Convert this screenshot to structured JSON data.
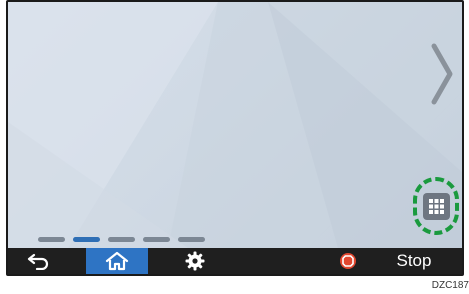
{
  "bottom_bar": {
    "back_icon": "back-arrow-icon",
    "home_icon": "home-icon",
    "settings_icon": "gear-icon",
    "stop_icon": "stop-icon",
    "stop_label": "Stop"
  },
  "home": {
    "page_count": 5,
    "active_page": 2,
    "next_page_icon": "chevron-right-icon",
    "app_list_icon": "grid-icon"
  },
  "figure_code": "DZC187",
  "colors": {
    "bar_background": "#1f1f1f",
    "home_active": "#2e74c4",
    "stop_red": "#e2472f",
    "highlight_green": "#1a9a3e",
    "active_dot": "#2f6fb5"
  }
}
